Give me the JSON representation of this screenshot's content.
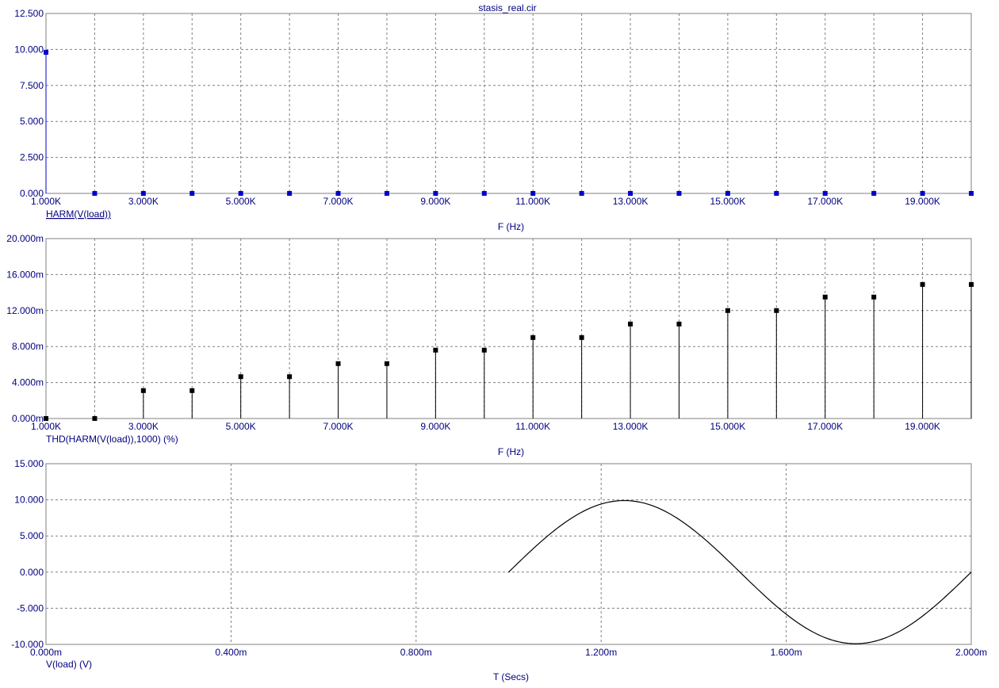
{
  "window_title": "stasis_real.cir",
  "chart_data": [
    {
      "type": "scatter",
      "series": [
        {
          "name": "HARM(V(load))",
          "x": [
            1000,
            2000,
            3000,
            4000,
            5000,
            6000,
            7000,
            8000,
            9000,
            10000,
            11000,
            12000,
            13000,
            14000,
            15000,
            16000,
            17000,
            18000,
            19000,
            20000
          ],
          "y": [
            9.8,
            0,
            0,
            0,
            0,
            0,
            0,
            0,
            0,
            0,
            0,
            0,
            0,
            0,
            0,
            0,
            0,
            0,
            0,
            0
          ]
        }
      ],
      "xlabel": "F (Hz)",
      "ylabel": "",
      "trace_label": "HARM(V(load))",
      "xlim": [
        1000,
        20000
      ],
      "ylim": [
        0,
        12.5
      ],
      "xticks": [
        1000,
        3000,
        5000,
        7000,
        9000,
        11000,
        13000,
        15000,
        17000,
        19000
      ],
      "xtick_labels": [
        "1.000K",
        "3.000K",
        "5.000K",
        "7.000K",
        "9.000K",
        "11.000K",
        "13.000K",
        "15.000K",
        "17.000K",
        "19.000K"
      ],
      "yticks": [
        0,
        2.5,
        5,
        7.5,
        10,
        12.5
      ],
      "ytick_labels": [
        "0.000",
        "2.500",
        "5.000",
        "7.500",
        "10.000",
        "12.500"
      ],
      "grid": true,
      "marker_color": "#0000cc",
      "stem_color": "#0000cc"
    },
    {
      "type": "scatter",
      "series": [
        {
          "name": "THD(HARM(V(load)),1000) (%)",
          "x": [
            1000,
            2000,
            3000,
            4000,
            5000,
            6000,
            7000,
            8000,
            9000,
            10000,
            11000,
            12000,
            13000,
            14000,
            15000,
            16000,
            17000,
            18000,
            19000,
            20000
          ],
          "y": [
            0,
            0,
            3.1,
            3.1,
            4.65,
            4.65,
            6.1,
            6.1,
            7.6,
            7.6,
            9.0,
            9.0,
            10.5,
            10.5,
            12.0,
            12.0,
            13.5,
            13.5,
            14.9,
            14.9
          ]
        }
      ],
      "xlabel": "F (Hz)",
      "ylabel": "",
      "trace_label": "THD(HARM(V(load)),1000) (%)",
      "y_unit_note": "milli",
      "xlim": [
        1000,
        20000
      ],
      "ylim": [
        0,
        20
      ],
      "xticks": [
        1000,
        3000,
        5000,
        7000,
        9000,
        11000,
        13000,
        15000,
        17000,
        19000
      ],
      "xtick_labels": [
        "1.000K",
        "3.000K",
        "5.000K",
        "7.000K",
        "9.000K",
        "11.000K",
        "13.000K",
        "15.000K",
        "17.000K",
        "19.000K"
      ],
      "yticks": [
        0,
        4,
        8,
        12,
        16,
        20
      ],
      "ytick_labels": [
        "0.000m",
        "4.000m",
        "8.000m",
        "12.000m",
        "16.000m",
        "20.000m"
      ],
      "grid": true,
      "marker_color": "#000000",
      "stem_color": "#000000"
    },
    {
      "type": "line",
      "series": [
        {
          "name": "V(load) (V)",
          "x_start": 1.0,
          "x_end": 2.0,
          "function": "sine",
          "amplitude": 9.9,
          "frequency_khz": 1.0,
          "offset": 0
        }
      ],
      "xlabel": "T (Secs)",
      "ylabel": "",
      "trace_label": "V(load) (V)",
      "xlim": [
        0,
        2.0
      ],
      "ylim": [
        -10,
        15
      ],
      "xticks": [
        0,
        0.4,
        0.8,
        1.2,
        1.6,
        2.0
      ],
      "xtick_labels": [
        "0.000m",
        "0.400m",
        "0.800m",
        "1.200m",
        "1.600m",
        "2.000m"
      ],
      "yticks": [
        -10,
        -5,
        0,
        5,
        10,
        15
      ],
      "ytick_labels": [
        "-10.000",
        "-5.000",
        "0.000",
        "5.000",
        "10.000",
        "15.000"
      ],
      "grid": true,
      "line_color": "#000000"
    }
  ]
}
